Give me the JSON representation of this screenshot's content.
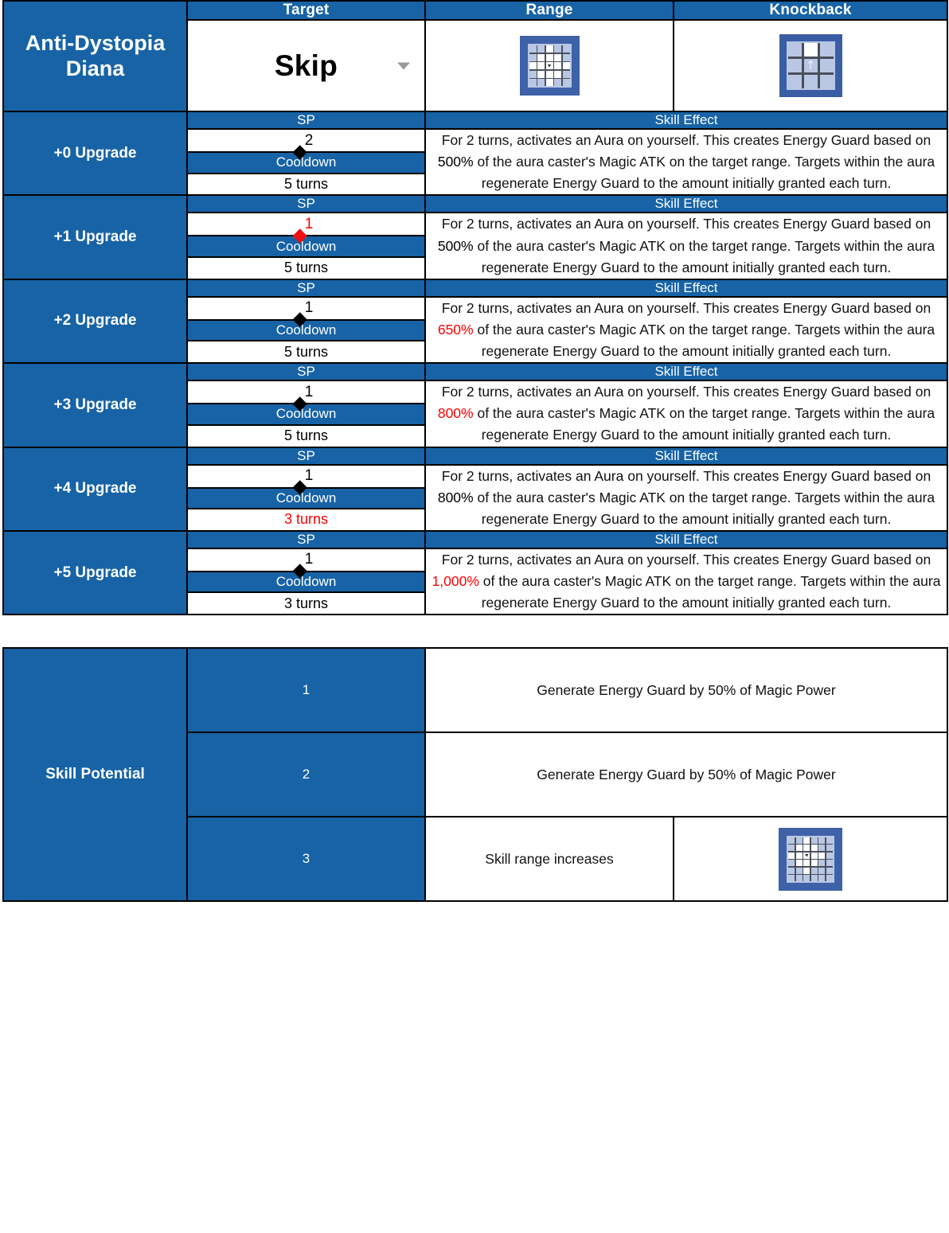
{
  "header": {
    "character_name": "Anti-Dystopia\nDiana",
    "columns": {
      "target": "Target",
      "range": "Range",
      "knockback": "Knockback"
    },
    "target_value": "Skip",
    "target_dropdown_icon": "chevron-down-icon",
    "range_icon": "range-grid-icon",
    "knockback_icon": "knockback-grid-icon"
  },
  "labels": {
    "sp": "SP",
    "cooldown": "Cooldown",
    "skill_effect": "Skill Effect"
  },
  "upgrades": [
    {
      "name": "+0 Upgrade",
      "sp_cost": "2",
      "sp_color": "#000000",
      "cooldown": "5 turns",
      "cooldown_color": "#000000",
      "effect_pre": "For 2 turns, activates an Aura on yourself. This creates Energy Guard based on ",
      "effect_value": "500%",
      "effect_value_color": "#000000",
      "effect_post": " of the aura caster's Magic ATK on the target range. Targets within the aura regenerate Energy Guard to the amount initially granted each turn."
    },
    {
      "name": "+1 Upgrade",
      "sp_cost": "1",
      "sp_color": "#ff0000",
      "cooldown": "5 turns",
      "cooldown_color": "#000000",
      "effect_pre": "For 2 turns, activates an Aura on yourself. This creates Energy Guard based on ",
      "effect_value": "500%",
      "effect_value_color": "#000000",
      "effect_post": " of the aura caster's Magic ATK on the target range. Targets within the aura regenerate Energy Guard to the amount initially granted each turn."
    },
    {
      "name": "+2 Upgrade",
      "sp_cost": "1",
      "sp_color": "#000000",
      "cooldown": "5 turns",
      "cooldown_color": "#000000",
      "effect_pre": "For 2 turns, activates an Aura on yourself. This creates Energy Guard based on ",
      "effect_value": "650%",
      "effect_value_color": "#ff0000",
      "effect_post": " of the aura caster's Magic ATK on the target range. Targets within the aura regenerate Energy Guard to the amount initially granted each turn."
    },
    {
      "name": "+3 Upgrade",
      "sp_cost": "1",
      "sp_color": "#000000",
      "cooldown": "5 turns",
      "cooldown_color": "#000000",
      "effect_pre": "For 2 turns, activates an Aura on yourself. This creates Energy Guard based on ",
      "effect_value": "800%",
      "effect_value_color": "#ff0000",
      "effect_post": " of the aura caster's Magic ATK on the target range. Targets within the aura regenerate Energy Guard to the amount initially granted each turn."
    },
    {
      "name": "+4 Upgrade",
      "sp_cost": "1",
      "sp_color": "#000000",
      "cooldown": "3 turns",
      "cooldown_color": "#ff0000",
      "effect_pre": "For 2 turns, activates an Aura on yourself. This creates Energy Guard based on ",
      "effect_value": "800%",
      "effect_value_color": "#000000",
      "effect_post": " of the aura caster's Magic ATK on the target range. Targets within the aura regenerate Energy Guard to the amount initially granted each turn."
    },
    {
      "name": "+5 Upgrade",
      "sp_cost": "1",
      "sp_color": "#000000",
      "cooldown": "3 turns",
      "cooldown_color": "#000000",
      "effect_pre": "For 2 turns, activates an Aura on yourself. This creates Energy Guard based on ",
      "effect_value": "1,000%",
      "effect_value_color": "#ff0000",
      "effect_post": " of the aura caster's Magic ATK on the target range. Targets within the aura regenerate Energy Guard to the amount initially granted each turn."
    }
  ],
  "skill_potential": {
    "label": "Skill Potential",
    "rows": [
      {
        "num": "1",
        "text": "Generate Energy Guard by 50% of Magic Power",
        "icon": ""
      },
      {
        "num": "2",
        "text": "Generate Energy Guard by 50% of Magic Power",
        "icon": ""
      },
      {
        "num": "3",
        "text": "Skill range increases",
        "icon": "range-grid-large-icon"
      }
    ]
  },
  "colors": {
    "header_blue": "#1763A6",
    "highlight_red": "#ff0000",
    "icon_tile_blue": "#3E61A8",
    "icon_cell_blue": "#b9c7e4",
    "icon_cell_white": "#ffffff",
    "text_black": "#000000"
  }
}
